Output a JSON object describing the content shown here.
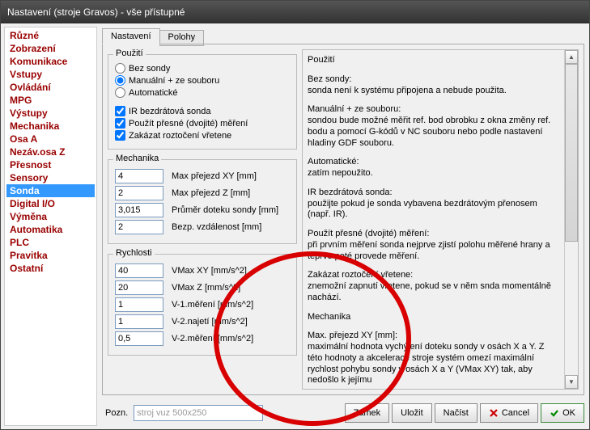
{
  "window": {
    "title": "Nastavení (stroje Gravos) - vše přístupné"
  },
  "sidebar": {
    "items": [
      "Různé",
      "Zobrazení",
      "Komunikace",
      "Vstupy",
      "Ovládání",
      "MPG",
      "Výstupy",
      "Mechanika",
      "Osa A",
      "Nezáv.osa Z",
      "Přesnost",
      "Sensory",
      "Sonda",
      "Digital I/O",
      "Výměna",
      "Automatika",
      "PLC",
      "Pravitka",
      "Ostatní"
    ],
    "selected_index": 12
  },
  "tabs": {
    "items": [
      "Nastavení",
      "Polohy"
    ],
    "active_index": 0
  },
  "groups": {
    "pouziti": {
      "title": "Použití",
      "radios": [
        {
          "label": "Bez sondy",
          "checked": false
        },
        {
          "label": "Manuální + ze souboru",
          "checked": true
        },
        {
          "label": "Automatické",
          "checked": false
        }
      ],
      "checks": [
        {
          "label": "IR bezdrátová sonda",
          "checked": true
        },
        {
          "label": "Použít přesné (dvojité) měření",
          "checked": true
        },
        {
          "label": "Zakázat roztočení vřetene",
          "checked": true
        }
      ]
    },
    "mechanika": {
      "title": "Mechanika",
      "fields": [
        {
          "value": "4",
          "label": "Max přejezd XY [mm]"
        },
        {
          "value": "2",
          "label": "Max přejezd Z [mm]"
        },
        {
          "value": "3,015",
          "label": "Průměr doteku sondy [mm]"
        },
        {
          "value": "2",
          "label": "Bezp. vzdálenost  [mm]"
        }
      ]
    },
    "rychlosti": {
      "title": "Rychlosti",
      "fields": [
        {
          "value": "40",
          "label": "VMax XY [mm/s^2]"
        },
        {
          "value": "20",
          "label": "VMax Z [mm/s^2]"
        },
        {
          "value": "1",
          "label": "V-1.měření [mm/s^2]"
        },
        {
          "value": "1",
          "label": "V-2.najetí [mm/s^2]"
        },
        {
          "value": "0,5",
          "label": "V-2.měření [mm/s^2]"
        }
      ]
    }
  },
  "rightcol": {
    "paragraphs": [
      "Použití",
      "Bez sondy:\nsonda není k systému připojena a nebude použita.",
      "Manuální + ze souboru:\nsondou bude možné měřit ref. bod obrobku z okna změny ref. bodu a pomocí G-kódů v NC souboru nebo podle nastavení hladiny GDF souboru.",
      "Automatické:\nzatím nepoužito.",
      "IR bezdrátová sonda:\npoužijte pokud je sonda vybavena bezdrátovým přenosem (např. IR).",
      "Použít přesné (dvojité) měření:\npři prvním měření sonda nejprve zjistí polohu měřené hrany a teprve poté provede měření.",
      "Zakázat roztočení vřetene:\nznemožní zapnutí vřetene, pokud se v něm snda momentálně nachází.",
      "Mechanika",
      "Max. přejezd XY [mm]:\nmaximální hodnota vychýlení doteku sondy v osách X a Y. Z této hodnoty a akcelerace stroje systém omezí maximální rychlost pohybu sondy v osách X a Y (VMax XY) tak, aby nedošlo k jejímu"
    ]
  },
  "buttonbar": {
    "pozn_label": "Pozn.",
    "pozn_value": "stroj vuz 500x250",
    "buttons": {
      "zamek": "Zámek",
      "ulozit": "Uložit",
      "nacist": "Načíst",
      "cancel": "Cancel",
      "ok": "OK"
    }
  }
}
